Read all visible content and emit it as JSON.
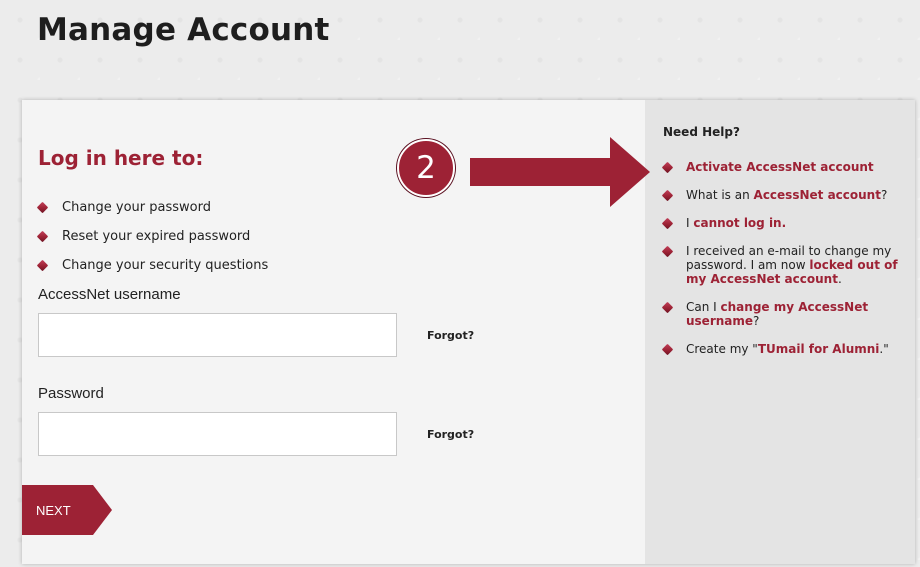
{
  "page": {
    "title": "Manage Account"
  },
  "login": {
    "heading": "Log in here to:",
    "bullets": [
      "Change your password",
      "Reset your expired password",
      "Change your security questions"
    ]
  },
  "form": {
    "username_label": "AccessNet username",
    "username_value": "",
    "password_label": "Password",
    "password_value": "",
    "forgot_label": "Forgot?",
    "next_label": "NEXT"
  },
  "help": {
    "heading": "Need Help?",
    "items": [
      {
        "pre": "",
        "link": "Activate AccessNet account",
        "post": ""
      },
      {
        "pre": "What is an ",
        "link": "AccessNet account",
        "post": "?"
      },
      {
        "pre": "I ",
        "link": "cannot log in.",
        "post": ""
      },
      {
        "pre": "I received an e-mail to change my password. I am now ",
        "link": "locked out of my AccessNet account",
        "post": "."
      },
      {
        "pre": "Can I ",
        "link": "change my AccessNet username",
        "post": "?"
      },
      {
        "pre": "Create my \"",
        "link": "TUmail for Alumni",
        "post": ".\""
      }
    ]
  },
  "annotation": {
    "step_number": "2"
  },
  "colors": {
    "brand": "#9d2235",
    "text": "#222222",
    "sidebar_bg": "#e4e4e4"
  }
}
